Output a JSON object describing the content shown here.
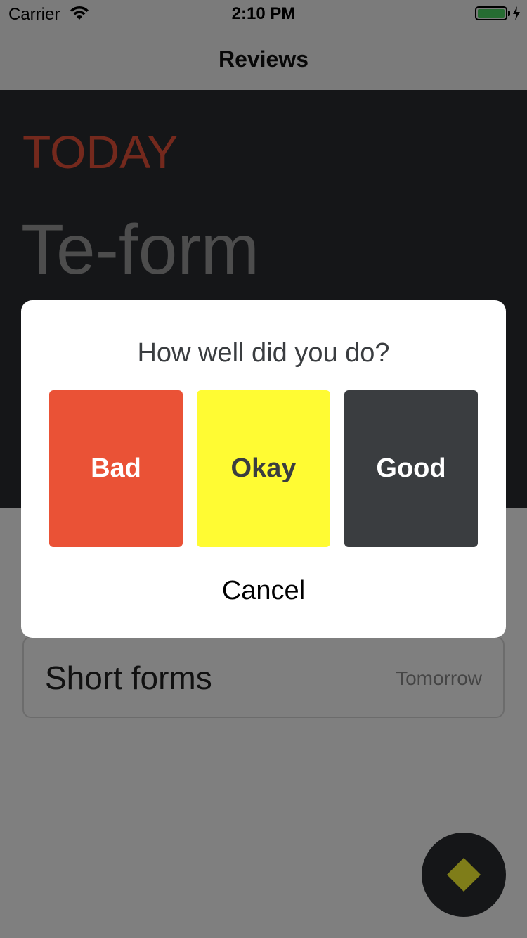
{
  "status_bar": {
    "carrier": "Carrier",
    "time": "2:10 PM",
    "battery_color": "#4cd964"
  },
  "nav": {
    "title": "Reviews"
  },
  "hero": {
    "label": "TODAY",
    "title": "Te-form",
    "label_color": "#e8523a",
    "background": "#2a2d31"
  },
  "list": {
    "items": [
      {
        "title": "Short forms",
        "date": "Tomorrow"
      }
    ]
  },
  "modal": {
    "question": "How well did you do?",
    "options": [
      {
        "label": "Bad",
        "color": "#ea5236"
      },
      {
        "label": "Okay",
        "color": "#fffb33"
      },
      {
        "label": "Good",
        "color": "#3a3d40"
      }
    ],
    "cancel_label": "Cancel"
  },
  "fab": {
    "icon": "diamond-icon",
    "icon_color": "#fffb33"
  }
}
